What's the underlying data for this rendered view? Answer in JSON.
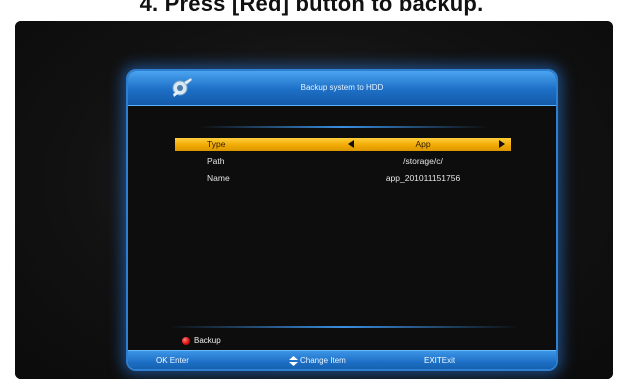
{
  "document": {
    "heading": "4.     Press [Red] button to backup."
  },
  "window": {
    "title": "Backup system to HDD"
  },
  "fields": [
    {
      "label": "Type",
      "value": "App",
      "selected": true
    },
    {
      "label": "Path",
      "value": "/storage/c/",
      "selected": false
    },
    {
      "label": "Name",
      "value": "app_201011151756",
      "selected": false
    }
  ],
  "actions": {
    "backup_label": "Backup"
  },
  "footer": {
    "ok_key": "OK",
    "ok_label": "Enter",
    "change_label": "Change Item",
    "exit_key": "EXIT",
    "exit_label": "Exit"
  },
  "colors": {
    "selected_row": "#f0a800",
    "window_border": "#2f7fd0",
    "title_bar": "#1d6fc6",
    "red_button": "#e01010"
  },
  "icons": {
    "app": "gear-wrench-icon",
    "left": "triangle-left-icon",
    "right": "triangle-right-icon",
    "red": "red-dot-icon",
    "updown": "updown-arrows-icon"
  }
}
